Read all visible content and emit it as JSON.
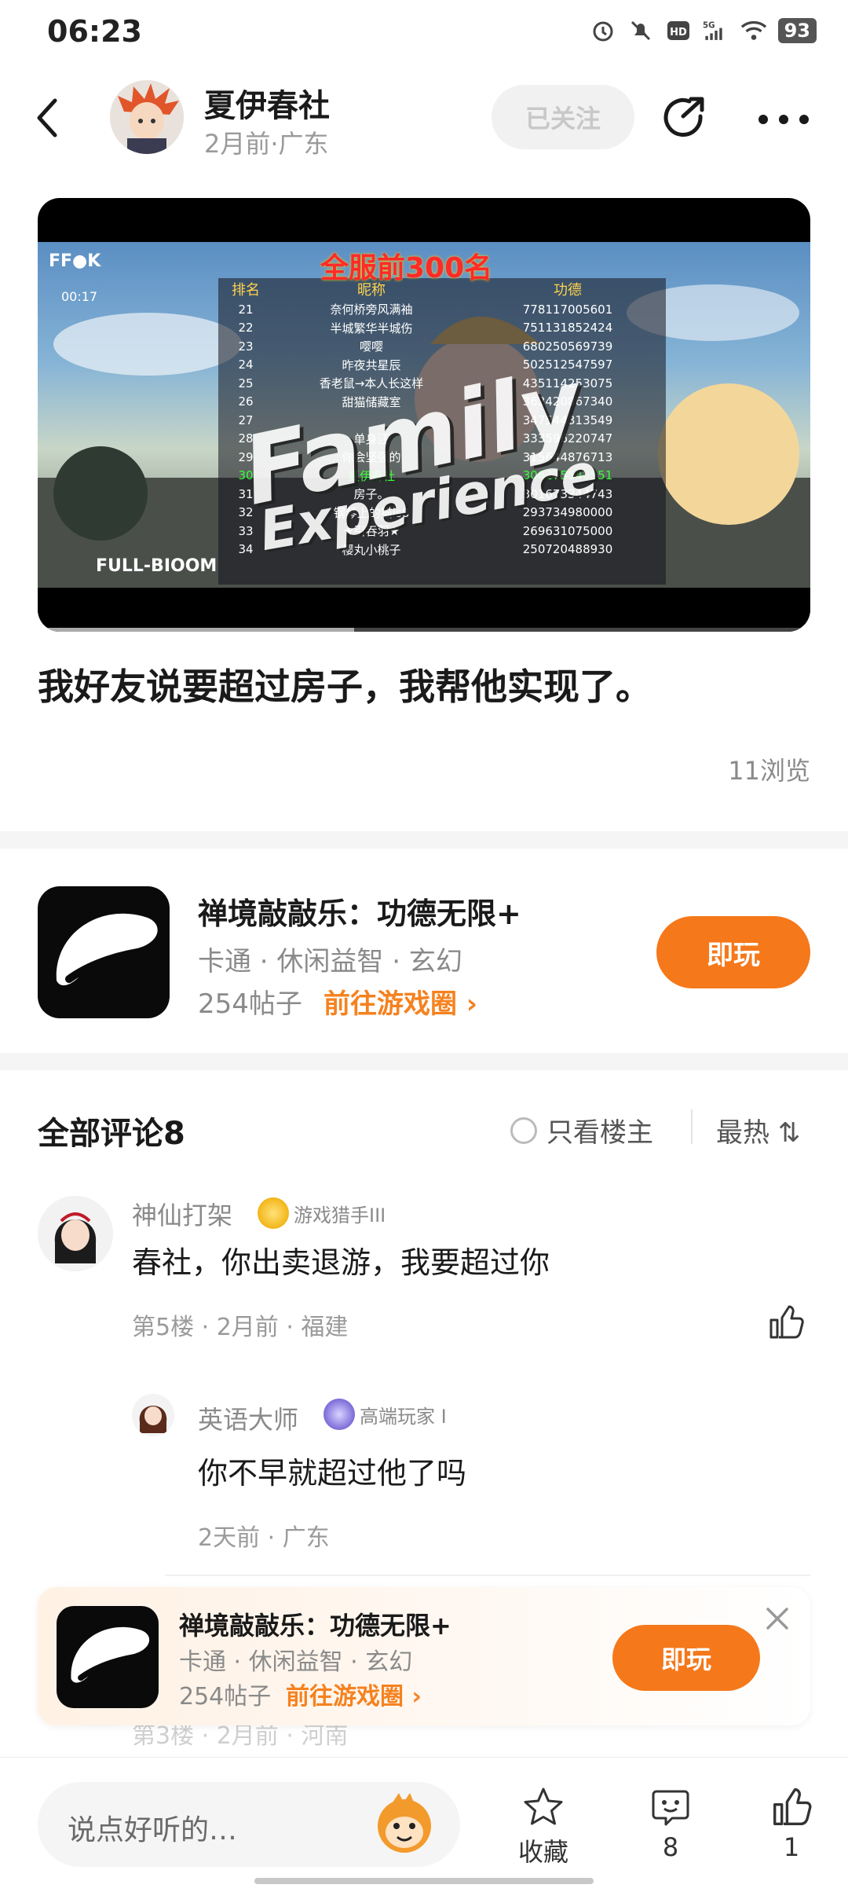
{
  "status": {
    "time": "06:23",
    "battery": "93",
    "network": "5G"
  },
  "header": {
    "author_name": "夏伊春社",
    "author_meta": "2月前·广东",
    "follow_label": "已关注"
  },
  "video": {
    "overlay_title": "全服前300名",
    "brand": "FF●K",
    "timestamp": "00:17",
    "table_headers": [
      "排名",
      "昵称",
      "功德"
    ],
    "rows": [
      {
        "rank": "21",
        "name": "奈何桥旁风满袖",
        "score": "778117005601"
      },
      {
        "rank": "22",
        "name": "半城繁华半城伤",
        "score": "751131852424"
      },
      {
        "rank": "23",
        "name": "嘤嘤",
        "score": "680250569739"
      },
      {
        "rank": "24",
        "name": "昨夜共星辰",
        "score": "502512547597"
      },
      {
        "rank": "25",
        "name": "香老鼠→本人长这样",
        "score": "435114253075"
      },
      {
        "rank": "26",
        "name": "甜猫储藏室",
        "score": "362420867340"
      },
      {
        "rank": "27",
        "name": "",
        "score": "347544313549"
      },
      {
        "rank": "28",
        "name": "单身汪",
        "score": "333596220747"
      },
      {
        "rank": "29",
        "name": "你会坚强的",
        "score": "315644876713"
      },
      {
        "rank": "30",
        "name": "夏伊春社",
        "score": "306275543551"
      },
      {
        "rank": "31",
        "name": "房子。",
        "score": "301673344743"
      },
      {
        "rank": "32",
        "name": "钢琴上的猫is8",
        "score": "293734980000"
      },
      {
        "rank": "33",
        "name": "★引吞羽★",
        "score": "269631075000"
      },
      {
        "rank": "34",
        "name": "樱丸小桃子",
        "score": "250720488930"
      }
    ],
    "big_word_1": "Family",
    "big_word_2": "Experience",
    "footer_brand": "FULL-BIOOM",
    "progress": 0.41
  },
  "post": {
    "text": "我好友说要超过房子，我帮他实现了。",
    "views": "11浏览"
  },
  "game": {
    "title": "禅境敲敲乐：功德无限+",
    "tags": "卡通 · 休闲益智 · 玄幻",
    "posts": "254帖子",
    "link": "前往游戏圈 ›",
    "play_label": "即玩"
  },
  "comments": {
    "title": "全部评论8",
    "only_owner": "只看楼主",
    "sort": "最热 ⇅",
    "items": [
      {
        "name": "神仙打架",
        "badge": "游戏猎手III",
        "text": "春社，你出卖退游，我要超过你",
        "meta": "第5楼 · 2月前 · 福建"
      }
    ],
    "reply": {
      "name": "英语大师",
      "badge": "高端玩家 I",
      "text": "你不早就超过他了吗",
      "meta": "2天前 · 广东"
    },
    "ghost_meta": "第3楼 · 2月前 · 河南"
  },
  "float_banner": {
    "title": "禅境敲敲乐：功德无限+",
    "tags": "卡通 · 休闲益智 · 玄幻",
    "posts": "254帖子",
    "link": "前往游戏圈 ›",
    "play_label": "即玩"
  },
  "bottom": {
    "input_placeholder": "说点好听的…",
    "favorite_label": "收藏",
    "comment_count": "8",
    "like_count": "1"
  },
  "colors": {
    "accent": "#f5781a",
    "link": "#f5821f",
    "muted": "#8a8a8a"
  }
}
